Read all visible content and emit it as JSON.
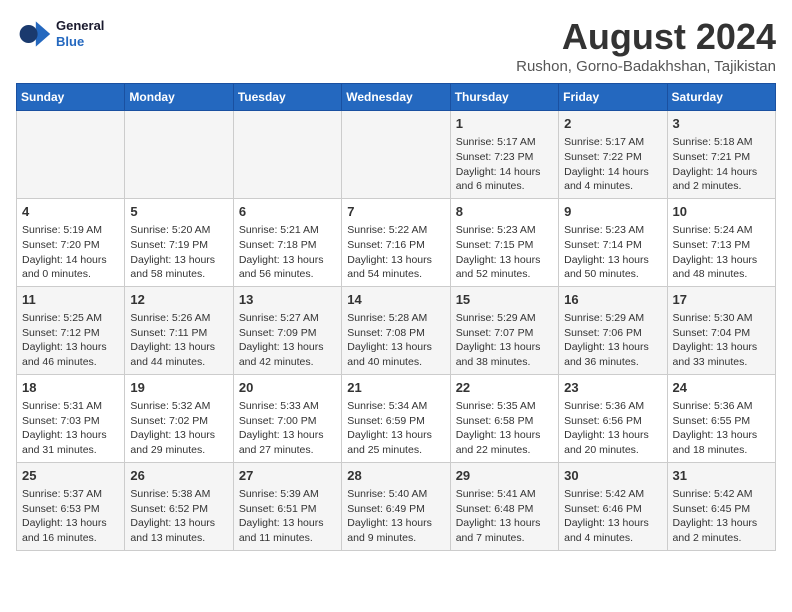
{
  "logo": {
    "line1": "General",
    "line2": "Blue"
  },
  "title": "August 2024",
  "location": "Rushon, Gorno-Badakhshan, Tajikistan",
  "weekdays": [
    "Sunday",
    "Monday",
    "Tuesday",
    "Wednesday",
    "Thursday",
    "Friday",
    "Saturday"
  ],
  "weeks": [
    [
      {
        "day": "",
        "info": ""
      },
      {
        "day": "",
        "info": ""
      },
      {
        "day": "",
        "info": ""
      },
      {
        "day": "",
        "info": ""
      },
      {
        "day": "1",
        "info": "Sunrise: 5:17 AM\nSunset: 7:23 PM\nDaylight: 14 hours\nand 6 minutes."
      },
      {
        "day": "2",
        "info": "Sunrise: 5:17 AM\nSunset: 7:22 PM\nDaylight: 14 hours\nand 4 minutes."
      },
      {
        "day": "3",
        "info": "Sunrise: 5:18 AM\nSunset: 7:21 PM\nDaylight: 14 hours\nand 2 minutes."
      }
    ],
    [
      {
        "day": "4",
        "info": "Sunrise: 5:19 AM\nSunset: 7:20 PM\nDaylight: 14 hours\nand 0 minutes."
      },
      {
        "day": "5",
        "info": "Sunrise: 5:20 AM\nSunset: 7:19 PM\nDaylight: 13 hours\nand 58 minutes."
      },
      {
        "day": "6",
        "info": "Sunrise: 5:21 AM\nSunset: 7:18 PM\nDaylight: 13 hours\nand 56 minutes."
      },
      {
        "day": "7",
        "info": "Sunrise: 5:22 AM\nSunset: 7:16 PM\nDaylight: 13 hours\nand 54 minutes."
      },
      {
        "day": "8",
        "info": "Sunrise: 5:23 AM\nSunset: 7:15 PM\nDaylight: 13 hours\nand 52 minutes."
      },
      {
        "day": "9",
        "info": "Sunrise: 5:23 AM\nSunset: 7:14 PM\nDaylight: 13 hours\nand 50 minutes."
      },
      {
        "day": "10",
        "info": "Sunrise: 5:24 AM\nSunset: 7:13 PM\nDaylight: 13 hours\nand 48 minutes."
      }
    ],
    [
      {
        "day": "11",
        "info": "Sunrise: 5:25 AM\nSunset: 7:12 PM\nDaylight: 13 hours\nand 46 minutes."
      },
      {
        "day": "12",
        "info": "Sunrise: 5:26 AM\nSunset: 7:11 PM\nDaylight: 13 hours\nand 44 minutes."
      },
      {
        "day": "13",
        "info": "Sunrise: 5:27 AM\nSunset: 7:09 PM\nDaylight: 13 hours\nand 42 minutes."
      },
      {
        "day": "14",
        "info": "Sunrise: 5:28 AM\nSunset: 7:08 PM\nDaylight: 13 hours\nand 40 minutes."
      },
      {
        "day": "15",
        "info": "Sunrise: 5:29 AM\nSunset: 7:07 PM\nDaylight: 13 hours\nand 38 minutes."
      },
      {
        "day": "16",
        "info": "Sunrise: 5:29 AM\nSunset: 7:06 PM\nDaylight: 13 hours\nand 36 minutes."
      },
      {
        "day": "17",
        "info": "Sunrise: 5:30 AM\nSunset: 7:04 PM\nDaylight: 13 hours\nand 33 minutes."
      }
    ],
    [
      {
        "day": "18",
        "info": "Sunrise: 5:31 AM\nSunset: 7:03 PM\nDaylight: 13 hours\nand 31 minutes."
      },
      {
        "day": "19",
        "info": "Sunrise: 5:32 AM\nSunset: 7:02 PM\nDaylight: 13 hours\nand 29 minutes."
      },
      {
        "day": "20",
        "info": "Sunrise: 5:33 AM\nSunset: 7:00 PM\nDaylight: 13 hours\nand 27 minutes."
      },
      {
        "day": "21",
        "info": "Sunrise: 5:34 AM\nSunset: 6:59 PM\nDaylight: 13 hours\nand 25 minutes."
      },
      {
        "day": "22",
        "info": "Sunrise: 5:35 AM\nSunset: 6:58 PM\nDaylight: 13 hours\nand 22 minutes."
      },
      {
        "day": "23",
        "info": "Sunrise: 5:36 AM\nSunset: 6:56 PM\nDaylight: 13 hours\nand 20 minutes."
      },
      {
        "day": "24",
        "info": "Sunrise: 5:36 AM\nSunset: 6:55 PM\nDaylight: 13 hours\nand 18 minutes."
      }
    ],
    [
      {
        "day": "25",
        "info": "Sunrise: 5:37 AM\nSunset: 6:53 PM\nDaylight: 13 hours\nand 16 minutes."
      },
      {
        "day": "26",
        "info": "Sunrise: 5:38 AM\nSunset: 6:52 PM\nDaylight: 13 hours\nand 13 minutes."
      },
      {
        "day": "27",
        "info": "Sunrise: 5:39 AM\nSunset: 6:51 PM\nDaylight: 13 hours\nand 11 minutes."
      },
      {
        "day": "28",
        "info": "Sunrise: 5:40 AM\nSunset: 6:49 PM\nDaylight: 13 hours\nand 9 minutes."
      },
      {
        "day": "29",
        "info": "Sunrise: 5:41 AM\nSunset: 6:48 PM\nDaylight: 13 hours\nand 7 minutes."
      },
      {
        "day": "30",
        "info": "Sunrise: 5:42 AM\nSunset: 6:46 PM\nDaylight: 13 hours\nand 4 minutes."
      },
      {
        "day": "31",
        "info": "Sunrise: 5:42 AM\nSunset: 6:45 PM\nDaylight: 13 hours\nand 2 minutes."
      }
    ]
  ]
}
